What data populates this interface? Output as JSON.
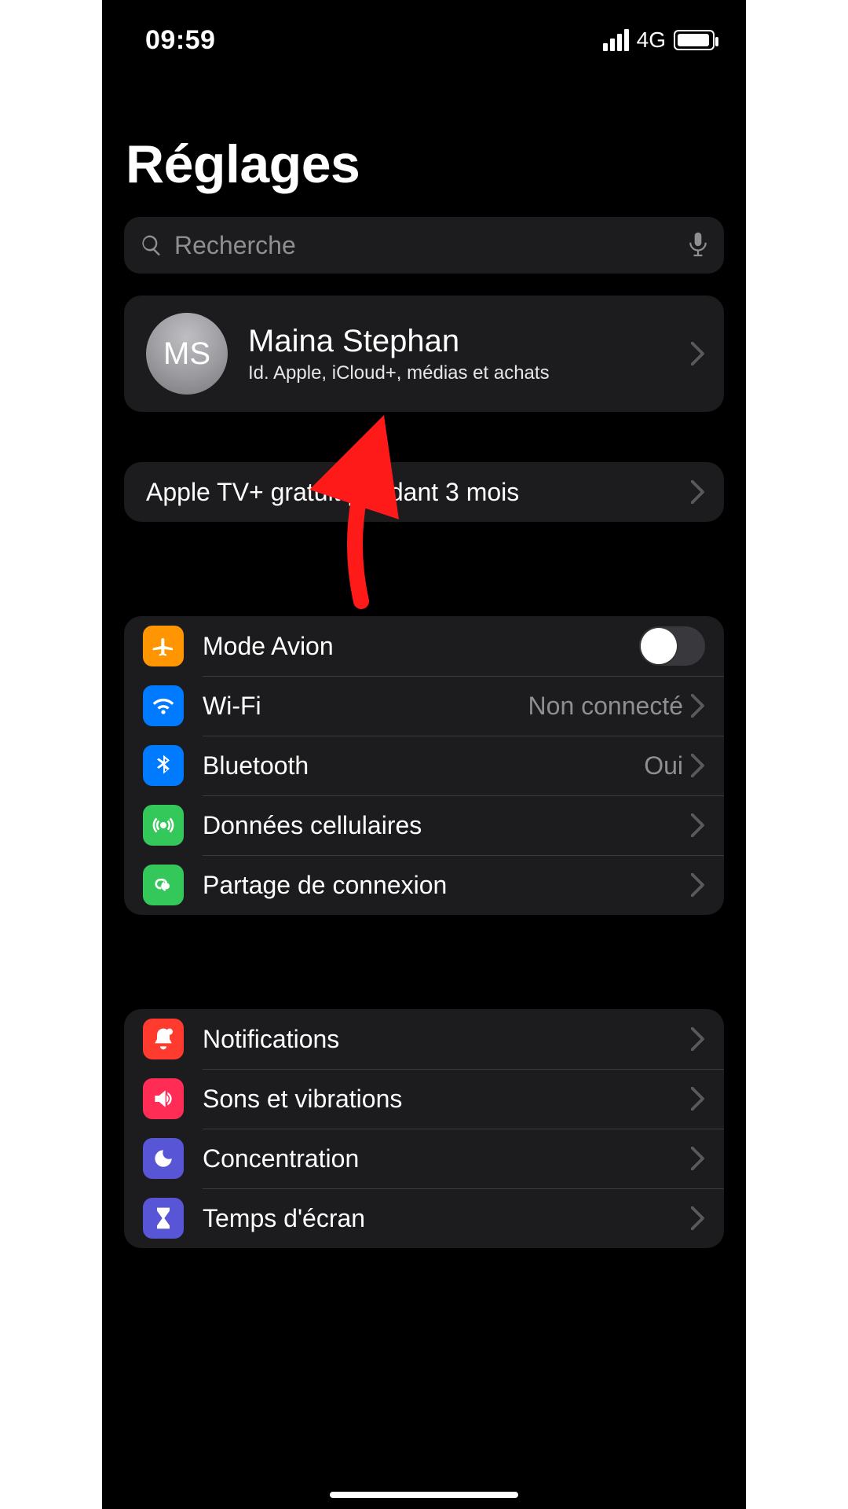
{
  "status_bar": {
    "time": "09:59",
    "network": "4G"
  },
  "page": {
    "title": "Réglages"
  },
  "search": {
    "placeholder": "Recherche"
  },
  "profile": {
    "initials": "MS",
    "name": "Maina Stephan",
    "subtitle": "Id. Apple, iCloud+, médias et achats"
  },
  "promo": {
    "label": "Apple TV+ gratuit pendant 3 mois"
  },
  "connectivity": {
    "airplane": {
      "label": "Mode Avion"
    },
    "wifi": {
      "label": "Wi-Fi",
      "value": "Non connecté"
    },
    "bluetooth": {
      "label": "Bluetooth",
      "value": "Oui"
    },
    "cellular": {
      "label": "Données cellulaires"
    },
    "hotspot": {
      "label": "Partage de connexion"
    }
  },
  "general": {
    "notifications": {
      "label": "Notifications"
    },
    "sounds": {
      "label": "Sons et vibrations"
    },
    "focus": {
      "label": "Concentration"
    },
    "screentime": {
      "label": "Temps d'écran"
    }
  },
  "colors": {
    "airplane": "#ff9500",
    "wifi": "#007aff",
    "bluetooth": "#007aff",
    "cellular": "#34c759",
    "hotspot": "#34c759",
    "notifications": "#ff3b30",
    "sounds": "#ff2d55",
    "focus": "#5856d6",
    "screentime": "#5856d6"
  }
}
